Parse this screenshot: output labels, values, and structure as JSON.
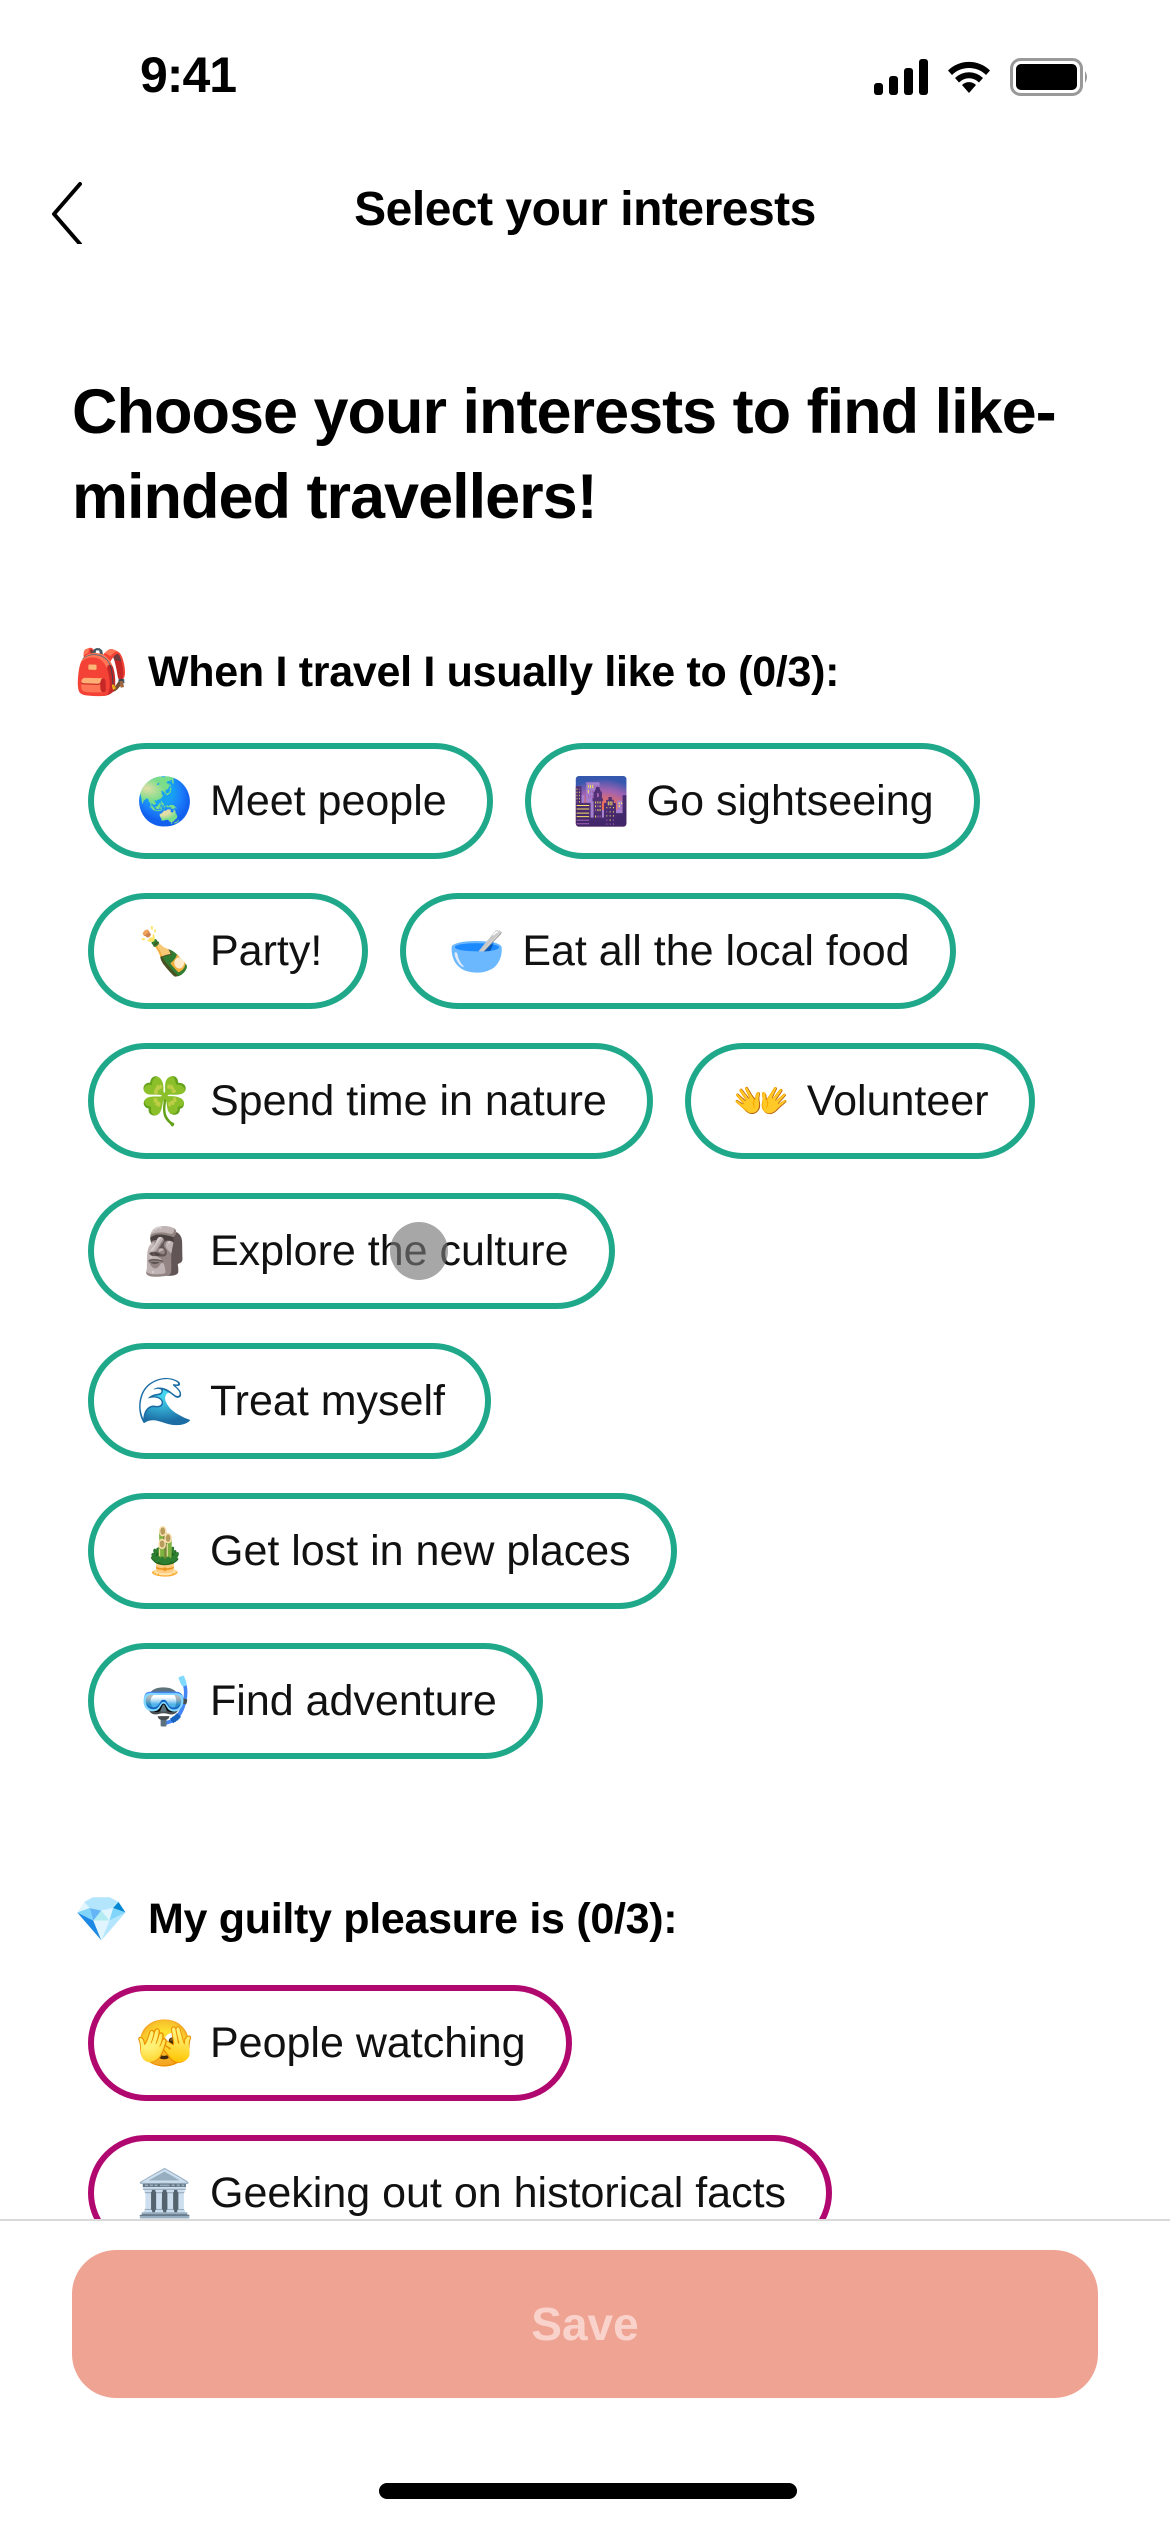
{
  "status_bar": {
    "time": "9:41",
    "icons": [
      "cellular-signal-icon",
      "wifi-icon",
      "battery-icon"
    ]
  },
  "nav": {
    "back_icon": "chevron-left-icon",
    "title": "Select your interests"
  },
  "headline": "Choose your interests to find like-minded travellers!",
  "sections": [
    {
      "emoji": "🎒",
      "title": "When I travel I usually like to (0/3):",
      "selected_count": 0,
      "max_count": 3,
      "accent_color": "#1fa98a",
      "options": [
        {
          "emoji": "🌏",
          "label": "Meet people",
          "selected": false
        },
        {
          "emoji": "🌆",
          "label": "Go sightseeing",
          "selected": false
        },
        {
          "emoji": "🍾",
          "label": "Party!",
          "selected": false
        },
        {
          "emoji": "🥣",
          "label": "Eat all the local food",
          "selected": false
        },
        {
          "emoji": "🍀",
          "label": "Spend time in nature",
          "selected": false
        },
        {
          "emoji": "👐",
          "label": "Volunteer",
          "selected": false
        },
        {
          "emoji": "🗿",
          "label": "Explore the culture",
          "selected": false
        },
        {
          "emoji": "🌊",
          "label": "Treat myself",
          "selected": false
        },
        {
          "emoji": "🎍",
          "label": "Get lost in new places",
          "selected": false
        },
        {
          "emoji": "🤿",
          "label": "Find adventure",
          "selected": false
        }
      ]
    },
    {
      "emoji": "💎",
      "title": "My guilty pleasure is (0/3):",
      "selected_count": 0,
      "max_count": 3,
      "accent_color": "#b0086f",
      "options": [
        {
          "emoji": "🫣",
          "label": "People watching",
          "selected": false
        },
        {
          "emoji": "🏛️",
          "label": "Geeking out on historical facts",
          "selected": false
        }
      ]
    }
  ],
  "footer": {
    "save_label": "Save",
    "save_enabled": false,
    "save_color": "#efa393"
  }
}
